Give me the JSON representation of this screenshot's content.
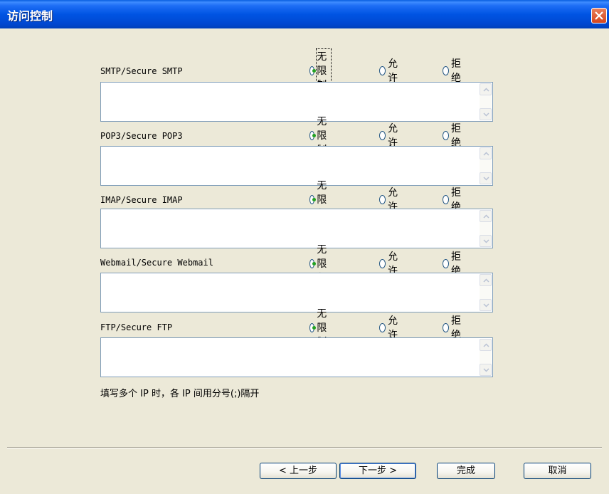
{
  "window": {
    "title": "访问控制"
  },
  "radio_labels": {
    "unlimited": "无限制",
    "allow": "允许",
    "deny": "拒绝"
  },
  "sections": [
    {
      "label": "SMTP/Secure SMTP",
      "selected": "unlimited"
    },
    {
      "label": "POP3/Secure POP3",
      "selected": "unlimited"
    },
    {
      "label": "IMAP/Secure IMAP",
      "selected": "unlimited"
    },
    {
      "label": "Webmail/Secure Webmail",
      "selected": "unlimited"
    },
    {
      "label": "FTP/Secure FTP",
      "selected": "unlimited"
    }
  ],
  "hint": "填写多个 IP 时，各 IP 间用分号(;)隔开",
  "buttons": {
    "back": "< 上一步",
    "next": "下一步 >",
    "finish": "完成",
    "cancel": "取消"
  },
  "colors": {
    "titlebar": "#0054e3",
    "dialog_bg": "#ece9d8",
    "close": "#d6451c",
    "radio_dot": "#21a121"
  }
}
